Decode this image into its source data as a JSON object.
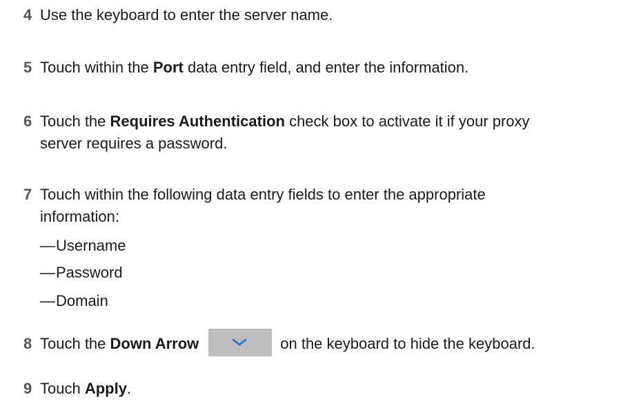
{
  "steps": [
    {
      "num": "4",
      "text": "Use the keyboard to enter the server name."
    },
    {
      "num": "5",
      "pre": "Touch within the ",
      "bold": "Port",
      "post": " data entry field, and enter the information."
    },
    {
      "num": "6",
      "pre": "Touch the ",
      "bold": "Requires Authentication",
      "post": " check box to activate it if your proxy",
      "line2": "server requires a password."
    },
    {
      "num": "7",
      "line1": "Touch within the following data entry fields to enter the appropriate",
      "line2": "information:"
    },
    {
      "num": "8",
      "pre": "Touch the ",
      "bold": "Down Arrow",
      "post": "on the keyboard to hide the keyboard."
    },
    {
      "num": "9",
      "pre": "Touch ",
      "bold": "Apply",
      "post": "."
    }
  ],
  "fields": [
    {
      "dash": "—",
      "label": "Username"
    },
    {
      "dash": "—",
      "label": "Password"
    },
    {
      "dash": "—",
      "label": "Domain"
    }
  ],
  "icons": {
    "down_arrow_key": "chevron-down-icon",
    "down_arrow_color": "#2a6fdb",
    "key_background": "#bdbdbd"
  }
}
